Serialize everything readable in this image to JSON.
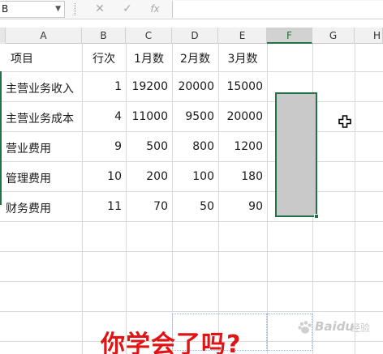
{
  "formula_bar": {
    "name_box": "B",
    "cancel_symbol": "✕",
    "enter_symbol": "✓",
    "function_symbol": "fx",
    "formula": ""
  },
  "columns": [
    "A",
    "B",
    "C",
    "D",
    "E",
    "F",
    "G",
    "H"
  ],
  "selected_column": "F",
  "header_row": [
    "项目",
    "行次",
    "1月数",
    "2月数",
    "3月数"
  ],
  "rows": [
    {
      "item": "主营业务收入",
      "line": "1",
      "m1": "19200",
      "m2": "20000",
      "m3": "15000"
    },
    {
      "item": "主营业务成本",
      "line": "4",
      "m1": "11000",
      "m2": "9500",
      "m3": "20000"
    },
    {
      "item": "营业费用",
      "line": "9",
      "m1": "500",
      "m2": "800",
      "m3": "1200"
    },
    {
      "item": "管理费用",
      "line": "10",
      "m1": "200",
      "m2": "100",
      "m3": "180"
    },
    {
      "item": "财务费用",
      "line": "11",
      "m1": "70",
      "m2": "50",
      "m3": "90"
    }
  ],
  "caption": "你学会了吗?",
  "watermark": {
    "brand": "Baidu",
    "sub": "经验"
  },
  "colors": {
    "selection_border": "#217346",
    "caption": "#e01414",
    "selection_fill": "#c9c9c9"
  },
  "icons": [
    "cancel-icon",
    "enter-icon",
    "function-icon",
    "cell-select-cursor-icon",
    "baidu-paw-icon"
  ]
}
